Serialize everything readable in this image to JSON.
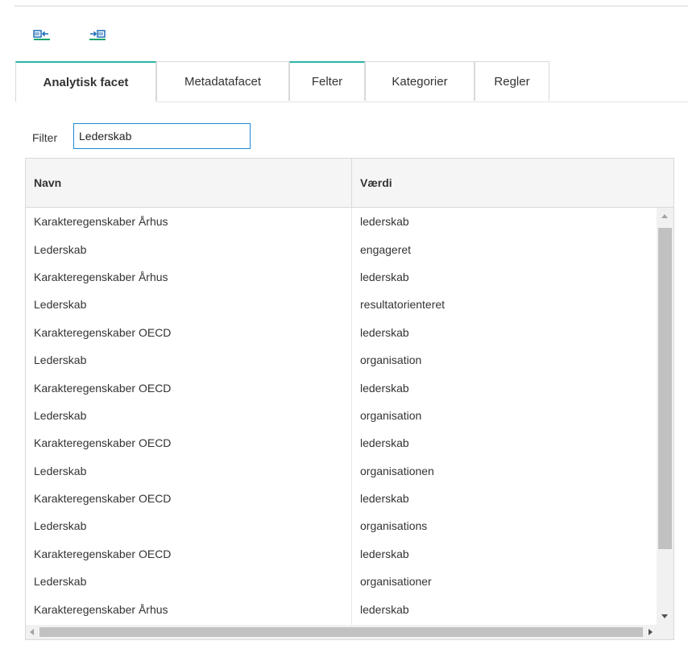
{
  "toolbar": {
    "collapse_icon": "panel-collapse-left-icon",
    "expand_icon": "panel-expand-right-icon"
  },
  "tabs": [
    {
      "label": "Analytisk facet",
      "active": true
    },
    {
      "label": "Metadatafacet",
      "active": false
    },
    {
      "label": "Felter",
      "active": false
    },
    {
      "label": "Kategorier",
      "active": false
    },
    {
      "label": "Regler",
      "active": false
    }
  ],
  "filter": {
    "label": "Filter",
    "value": "Lederskab"
  },
  "table": {
    "columns": [
      "Navn",
      "Værdi"
    ],
    "rows": [
      [
        "Karakteregenskaber Århus",
        "lederskab"
      ],
      [
        "Lederskab",
        "engageret"
      ],
      [
        "Karakteregenskaber Århus",
        "lederskab"
      ],
      [
        "Lederskab",
        "resultatorienteret"
      ],
      [
        "Karakteregenskaber OECD",
        "lederskab"
      ],
      [
        "Lederskab",
        "organisation"
      ],
      [
        "Karakteregenskaber OECD",
        "lederskab"
      ],
      [
        "Lederskab",
        "organisation"
      ],
      [
        "Karakteregenskaber OECD",
        "lederskab"
      ],
      [
        "Lederskab",
        "organisationen"
      ],
      [
        "Karakteregenskaber OECD",
        "lederskab"
      ],
      [
        "Lederskab",
        "organisations"
      ],
      [
        "Karakteregenskaber OECD",
        "lederskab"
      ],
      [
        "Lederskab",
        "organisationer"
      ],
      [
        "Karakteregenskaber Århus",
        "lederskab"
      ]
    ]
  },
  "colors": {
    "accent": "#2bb5a8",
    "input_focus": "#1e88d8",
    "icon_green": "#1aa36b",
    "icon_blue": "#1f6fb8"
  }
}
